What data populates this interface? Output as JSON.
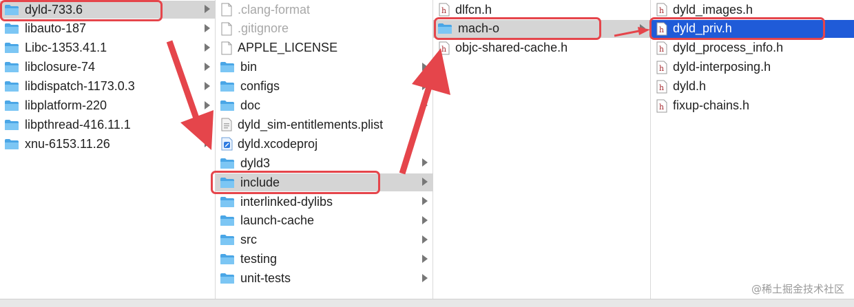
{
  "columns": [
    {
      "items": [
        {
          "label": "dyld-733.6",
          "icon": "folder-icon",
          "state": "gray",
          "chevron": true
        },
        {
          "label": "libauto-187",
          "icon": "folder-icon",
          "chevron": true
        },
        {
          "label": "Libc-1353.41.1",
          "icon": "folder-icon",
          "chevron": true
        },
        {
          "label": "libclosure-74",
          "icon": "folder-icon",
          "chevron": true
        },
        {
          "label": "libdispatch-1173.0.3",
          "icon": "folder-icon",
          "chevron": true
        },
        {
          "label": "libplatform-220",
          "icon": "folder-icon",
          "chevron": true
        },
        {
          "label": "libpthread-416.11.1",
          "icon": "folder-icon",
          "chevron": true
        },
        {
          "label": "xnu-6153.11.26",
          "icon": "folder-icon",
          "chevron": true
        }
      ]
    },
    {
      "items": [
        {
          "label": ".clang-format",
          "icon": "file-icon",
          "dim": true
        },
        {
          "label": ".gitignore",
          "icon": "file-icon",
          "dim": true
        },
        {
          "label": "APPLE_LICENSE",
          "icon": "file-icon"
        },
        {
          "label": "bin",
          "icon": "folder-icon",
          "chevron": true
        },
        {
          "label": "configs",
          "icon": "folder-icon",
          "chevron": true
        },
        {
          "label": "doc",
          "icon": "folder-icon",
          "chevron": true
        },
        {
          "label": "dyld_sim-entitlements.plist",
          "icon": "plist-file-icon"
        },
        {
          "label": "dyld.xcodeproj",
          "icon": "xcodeproj-icon"
        },
        {
          "label": "dyld3",
          "icon": "folder-icon",
          "chevron": true
        },
        {
          "label": "include",
          "icon": "folder-icon",
          "state": "gray",
          "chevron": true
        },
        {
          "label": "interlinked-dylibs",
          "icon": "folder-icon",
          "chevron": true
        },
        {
          "label": "launch-cache",
          "icon": "folder-icon",
          "chevron": true
        },
        {
          "label": "src",
          "icon": "folder-icon",
          "chevron": true
        },
        {
          "label": "testing",
          "icon": "folder-icon",
          "chevron": true
        },
        {
          "label": "unit-tests",
          "icon": "folder-icon",
          "chevron": true
        }
      ]
    },
    {
      "items": [
        {
          "label": "dlfcn.h",
          "icon": "header-file-icon"
        },
        {
          "label": "mach-o",
          "icon": "folder-icon",
          "state": "gray",
          "chevron": true
        },
        {
          "label": "objc-shared-cache.h",
          "icon": "header-file-icon"
        }
      ]
    },
    {
      "items": [
        {
          "label": "dyld_images.h",
          "icon": "header-file-icon"
        },
        {
          "label": "dyld_priv.h",
          "icon": "header-file-icon",
          "state": "blue"
        },
        {
          "label": "dyld_process_info.h",
          "icon": "header-file-icon"
        },
        {
          "label": "dyld-interposing.h",
          "icon": "header-file-icon"
        },
        {
          "label": "dyld.h",
          "icon": "header-file-icon"
        },
        {
          "label": "fixup-chains.h",
          "icon": "header-file-icon"
        }
      ]
    }
  ],
  "watermark": "@稀土掘金技术社区",
  "colors": {
    "highlight_box": "#e5454b",
    "selection_blue": "#1f5bd8",
    "selection_gray": "#d5d5d5",
    "folder": "#5fb6ee"
  }
}
